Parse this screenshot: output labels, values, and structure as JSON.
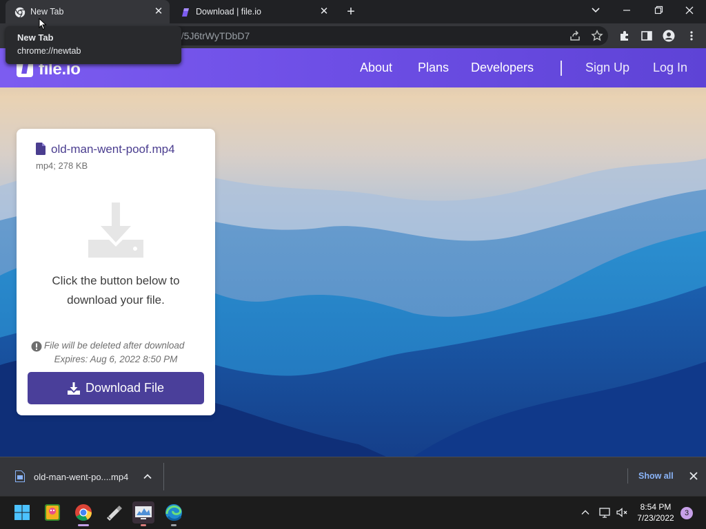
{
  "browser": {
    "tabs": [
      {
        "title": "New Tab",
        "active": true
      },
      {
        "title": "Download | file.io",
        "active": false
      }
    ],
    "new_tab_glyph": "+",
    "close_glyph": "✕",
    "url_partial": "d/5J6trWyTDbD7",
    "tooltip": {
      "title": "New Tab",
      "url": "chrome://newtab"
    },
    "toolbar_icons": [
      "share-icon",
      "star-icon",
      "extensions-icon",
      "side-panel-icon",
      "profile-icon",
      "menu-icon"
    ]
  },
  "site": {
    "logo": "file.io",
    "nav": {
      "about": "About",
      "plans": "Plans",
      "developers": "Developers",
      "signup": "Sign Up",
      "login": "Log In"
    },
    "brand_color": "#6e4fe6"
  },
  "card": {
    "file_name": "old-man-went-poof.mp4",
    "file_meta": "mp4; 278 KB",
    "instructions_line1": "Click the button below to",
    "instructions_line2": "download your file.",
    "deleted_note": "File will be deleted after download",
    "expires_note": "Expires: Aug 6, 2022 8:50 PM",
    "download_button": "Download File",
    "button_color": "#4a3f9a"
  },
  "download_shelf": {
    "file_name": "old-man-went-po....mp4",
    "show_all": "Show all"
  },
  "taskbar": {
    "apps": [
      "windows-start-icon",
      "app-icon",
      "chrome-icon",
      "tool-icon",
      "monitor-app-icon",
      "edge-icon"
    ],
    "time": "8:54 PM",
    "date": "7/23/2022",
    "notification_count": "3"
  }
}
